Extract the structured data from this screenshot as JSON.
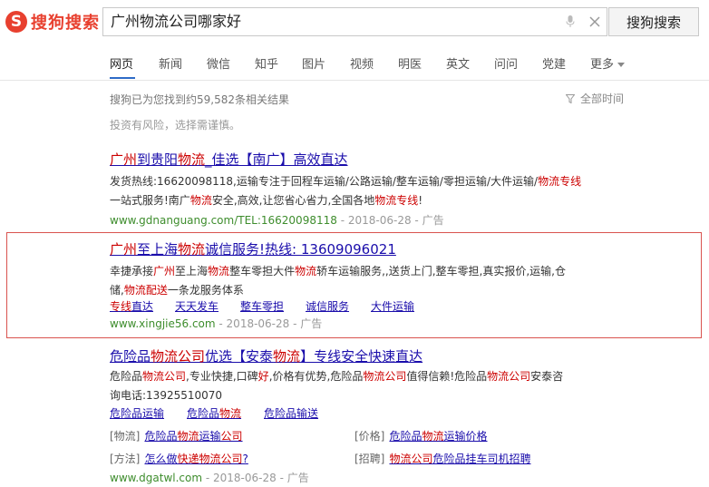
{
  "header": {
    "logo_mark": "S",
    "logo_text": "搜狗搜索",
    "query": "广州物流公司哪家好",
    "search_button": "搜狗搜索"
  },
  "nav": {
    "items": [
      "网页",
      "新闻",
      "微信",
      "知乎",
      "图片",
      "视频",
      "明医",
      "英文",
      "问问",
      "党建",
      "更多"
    ],
    "active": "网页"
  },
  "stats": {
    "found": "搜狗已为您找到约59,582条相关结果",
    "time_filter": "全部时间",
    "notice": "投资有风险，选择需谨慎。"
  },
  "results": [
    {
      "title_parts": [
        "广州",
        "到贵阳",
        "物流",
        "_佳选【南广】高效直达"
      ],
      "desc1_parts": [
        "发货热线:16620098118,运输专注于回程车运输/公路运输/整车运输/零担运输/大件运输/",
        "物流专线"
      ],
      "desc2_parts": [
        "一站式服务!南广",
        "物流",
        "安全,高效,让您省心省力,全国各地",
        "物流专线",
        "!"
      ],
      "url": "www.gdnanguang.com/TEL:16620098118",
      "date": "2018-06-28",
      "ad": "广告"
    },
    {
      "title_parts": [
        "广州",
        "至上海",
        "物流",
        "诚信服务!热线: 13609096021"
      ],
      "desc1_parts": [
        "幸捷承接",
        "广州",
        "至上海",
        "物流",
        "整车零担大件",
        "物流",
        "轿车运输服务,,送货上门,整车零担,真实报价,运输,仓"
      ],
      "desc2_parts": [
        "储,",
        "物流",
        "配送",
        "一条龙服务体系"
      ],
      "links": [
        {
          "parts": [
            "专线",
            "直达"
          ]
        },
        {
          "parts": [
            "天天发车"
          ]
        },
        {
          "parts": [
            "整车零担"
          ]
        },
        {
          "parts": [
            "诚信服务"
          ]
        },
        {
          "parts": [
            "大件运输"
          ]
        }
      ],
      "url": "www.xingjie56.com",
      "date": "2018-06-28",
      "ad": "广告"
    },
    {
      "title_parts": [
        "危险品",
        "物流公司",
        "优选【安泰",
        "物流",
        "】专线安全快速直达"
      ],
      "desc1_parts": [
        "危险品",
        "物流公司",
        ",专业快捷,口碑",
        "好",
        ",价格有优势,危险品",
        "物流公司",
        "值得信赖!危险品",
        "物流公司",
        "安泰咨"
      ],
      "desc2_parts": [
        "询电话:13925510070"
      ],
      "links": [
        {
          "parts": [
            "危险品运输"
          ]
        },
        {
          "parts": [
            "危险品",
            "物流"
          ]
        },
        {
          "parts": [
            "危险品输送"
          ]
        }
      ],
      "tags": [
        {
          "label": "[物流]",
          "parts": [
            "危险品",
            "物流",
            "运输",
            "公司"
          ]
        },
        {
          "label": "[价格]",
          "parts": [
            "危险品",
            "物流",
            "运输价格"
          ]
        },
        {
          "label": "[方法]",
          "parts": [
            "怎么做",
            "快递物流公司",
            "?"
          ]
        },
        {
          "label": "[招聘]",
          "parts": [
            "物流公司",
            "危险品挂车司机招聘"
          ]
        }
      ],
      "url": "www.dgatwl.com",
      "date": "2018-06-28",
      "ad": "广告"
    }
  ],
  "colors": {
    "brand": "#e8402f",
    "link": "#1a0dab",
    "highlight": "#cc0000",
    "url": "#3e8d2d",
    "nav_active": "#2e6bc7",
    "ad_border": "#d9534f"
  }
}
